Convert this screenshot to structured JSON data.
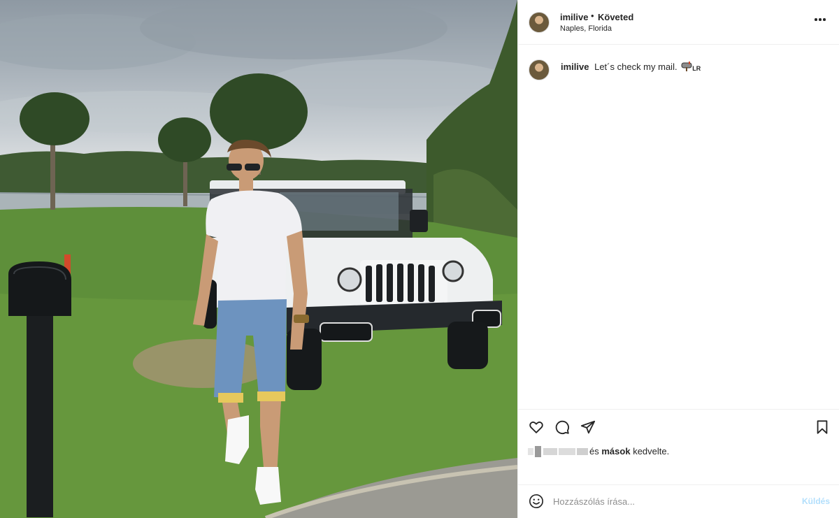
{
  "post": {
    "username": "imilive",
    "separator": "•",
    "follow_status": "Követed",
    "location": "Naples, Florida"
  },
  "caption": {
    "username": "imilive",
    "text": "Let´s check my mail.",
    "emoji_suffix": "LR"
  },
  "likes": {
    "connector": "és",
    "others": "mások",
    "suffix": "kedvelte."
  },
  "comment_box": {
    "placeholder": "Hozzászólás írása...",
    "send_label": "Küldés"
  },
  "icons": {
    "more": "more-options-icon",
    "like": "heart-icon",
    "comment": "comment-bubble-icon",
    "share": "paper-plane-icon",
    "save": "bookmark-icon",
    "emoji": "smiley-icon",
    "mailbox": "mailbox-icon"
  },
  "colors": {
    "text": "#262626",
    "secondary": "#8e8e8e",
    "send_disabled": "#b2dffc",
    "divider": "#efefef"
  }
}
